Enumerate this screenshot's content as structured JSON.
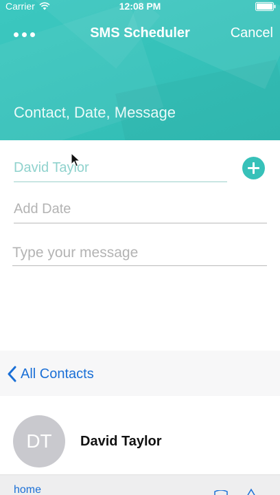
{
  "status_bar": {
    "carrier": "Carrier",
    "time": "12:08 PM"
  },
  "nav": {
    "title": "SMS Scheduler",
    "cancel_label": "Cancel"
  },
  "header": {
    "subtitle": "Contact, Date, Message"
  },
  "form": {
    "contact_value": "David Taylor",
    "date_placeholder": "Add Date",
    "message_placeholder": "Type your message"
  },
  "contacts": {
    "back_label": "All Contacts",
    "card": {
      "initials": "DT",
      "name": "David Taylor",
      "phone_label": "home"
    }
  },
  "colors": {
    "accent": "#37c1b9",
    "link": "#1a6fd6",
    "avatar": "#c9c9ce"
  }
}
